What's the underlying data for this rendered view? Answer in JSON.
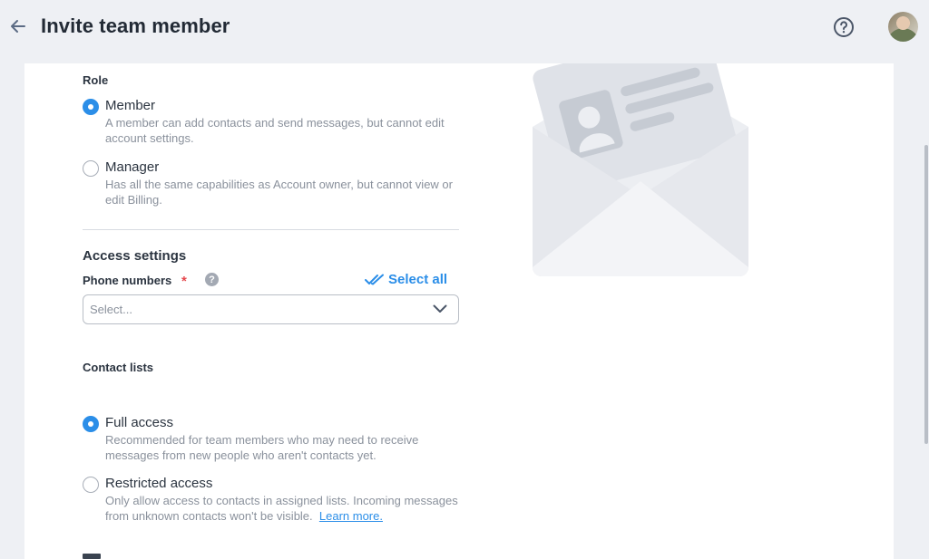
{
  "header": {
    "title": "Invite team member",
    "back_icon": "arrow-left-icon",
    "help_icon": "question-circle-icon",
    "avatar": "user-avatar"
  },
  "role": {
    "label": "Role",
    "options": [
      {
        "label": "Member",
        "description": "A member can add contacts and send messages, but cannot edit account settings.",
        "checked": true
      },
      {
        "label": "Manager",
        "description": "Has all the same capabilities as Account owner, but cannot view or edit Billing.",
        "checked": false
      }
    ]
  },
  "access_settings": {
    "title": "Access settings",
    "phone_numbers": {
      "label": "Phone numbers",
      "required_mark": "*",
      "info_icon": "?",
      "select_all_label": "Select all",
      "placeholder": "Select..."
    }
  },
  "contact_lists": {
    "label": "Contact lists",
    "options": [
      {
        "label": "Full access",
        "description": "Recommended for team members who may need to receive messages from new people who aren't contacts yet.",
        "checked": true
      },
      {
        "label": "Restricted access",
        "description": "Only allow access to contacts in assigned lists. Incoming messages from unknown contacts won't be visible.",
        "link_text": "Learn more.",
        "checked": false
      }
    ]
  },
  "colors": {
    "accent": "#2b8ee8",
    "required": "#e5484d",
    "background": "#eef0f4"
  }
}
